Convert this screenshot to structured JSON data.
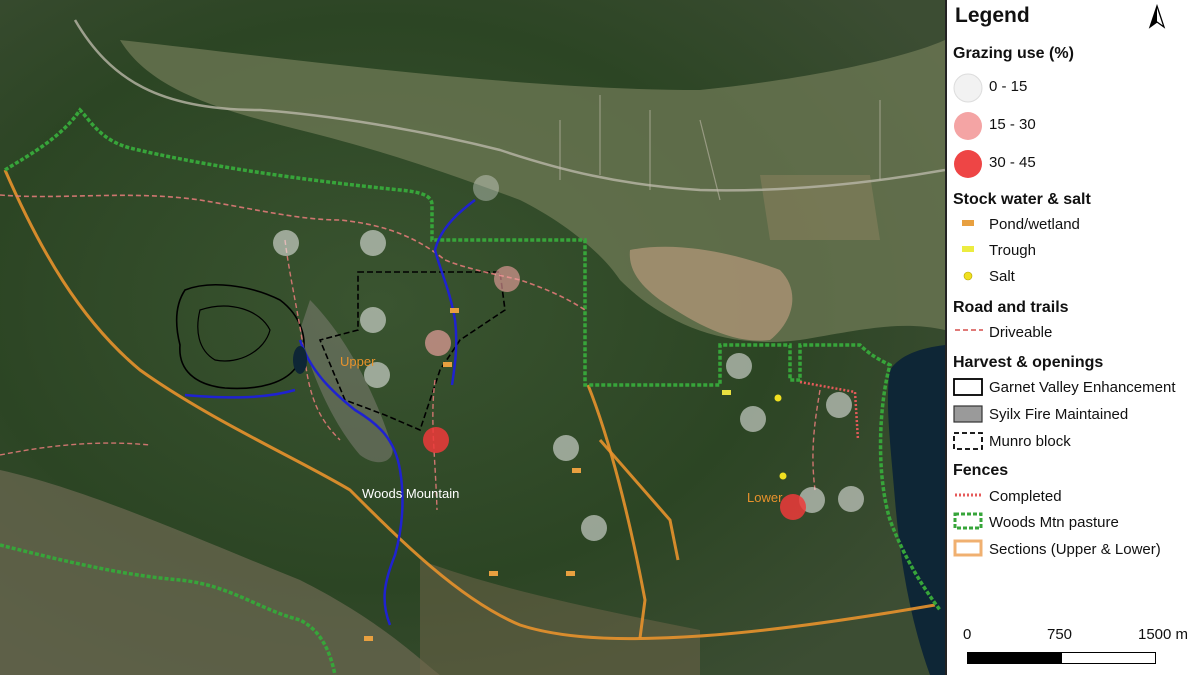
{
  "map": {
    "labels": {
      "upper": "Upper",
      "lower": "Lower",
      "woods_mountain": "Woods Mountain"
    },
    "colors": {
      "forest": "#2f4a26",
      "grassland": "#8a8a63",
      "lake": "#0e2636",
      "pasture_fence": "#37a53a",
      "sections": "#e8922c",
      "creek": "#1f22d0",
      "road": "#e07a78",
      "fence_completed": "#e65a5a"
    }
  },
  "legend": {
    "title": "Legend",
    "grazing": {
      "heading": "Grazing use (%)",
      "items": [
        {
          "label": "0 - 15",
          "color": "#f2f2f2"
        },
        {
          "label": "15 - 30",
          "color": "#f4a4a4"
        },
        {
          "label": "30 - 45",
          "color": "#ee4545"
        }
      ]
    },
    "water": {
      "heading": "Stock water & salt",
      "items": [
        {
          "label": "Pond/wetland",
          "icon": "pond-icon"
        },
        {
          "label": "Trough",
          "icon": "trough-icon"
        },
        {
          "label": "Salt",
          "icon": "salt-icon"
        }
      ]
    },
    "roads": {
      "heading": "Road and trails",
      "items": [
        {
          "label": "Driveable"
        }
      ]
    },
    "harvest": {
      "heading": "Harvest & openings",
      "items": [
        {
          "label": "Garnet Valley Enhancement"
        },
        {
          "label": "Syilx Fire Maintained"
        },
        {
          "label": "Munro block"
        }
      ]
    },
    "fences": {
      "heading": "Fences",
      "items": [
        {
          "label": "Completed"
        },
        {
          "label": "Woods Mtn pasture"
        },
        {
          "label": "Sections (Upper & Lower)"
        }
      ]
    },
    "scale": {
      "labels": [
        "0",
        "750",
        "1500 m"
      ]
    }
  }
}
